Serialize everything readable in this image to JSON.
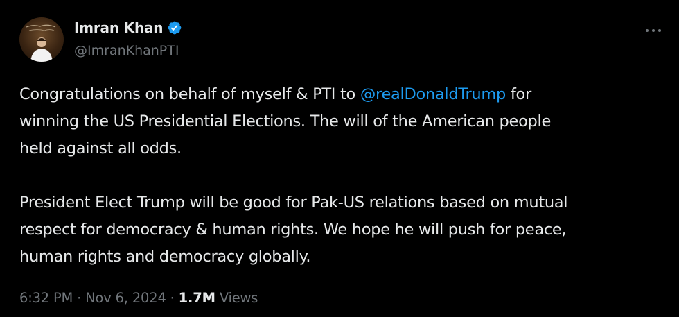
{
  "author": {
    "display_name": "Imran Khan",
    "handle": "@ImranKhanPTI",
    "verified": true,
    "avatar_icon": "profile-photo"
  },
  "tweet": {
    "line1_before": "Congratulations on behalf of myself & PTI to ",
    "mention": "@realDonaldTrump",
    "line1_after": " for",
    "line2": "winning the US Presidential Elections. The will of the American people",
    "line3": "held against all odds.",
    "line4": "President Elect Trump will be good for Pak-US relations based on mutual",
    "line5": "respect for democracy & human rights. We hope he will push for peace,",
    "line6": "human rights and democracy globally."
  },
  "meta": {
    "time": "6:32 PM",
    "separator": "·",
    "date": "Nov 6, 2024",
    "views_count": "1.7M",
    "views_label": "Views"
  },
  "colors": {
    "background": "#000000",
    "text": "#e7e9ea",
    "secondary": "#71767b",
    "accent": "#1d9bf0"
  }
}
